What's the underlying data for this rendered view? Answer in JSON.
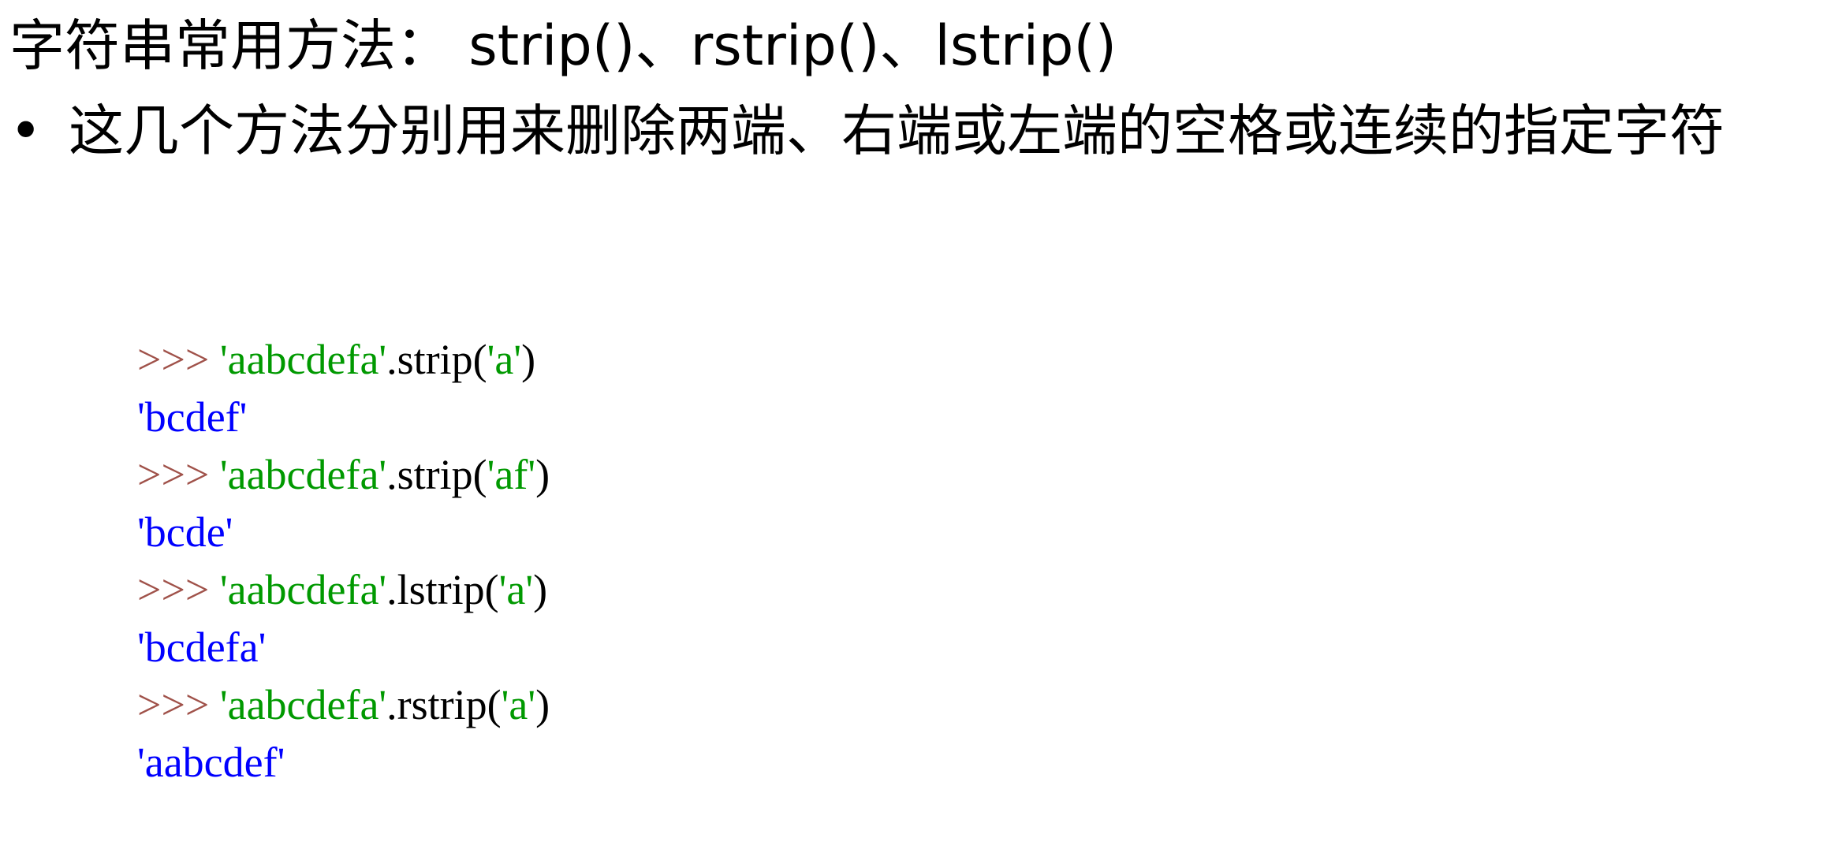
{
  "title": "字符串常用方法： strip()、rstrip()、lstrip()",
  "bullet": {
    "marker": "•",
    "text": "这几个方法分别用来删除两端、右端或左端的空格或连续的指定字符"
  },
  "colors": {
    "prompt": "#a0524a",
    "string": "#009900",
    "plain": "#000000",
    "output": "#0000ff"
  },
  "code": [
    {
      "kind": "input",
      "prompt": ">>> ",
      "str": "'aabcdefa'",
      "method": ".strip(",
      "arg": "'a'",
      "close": ")"
    },
    {
      "kind": "output",
      "text": "'bcdef'"
    },
    {
      "kind": "input",
      "prompt": ">>> ",
      "str": "'aabcdefa'",
      "method": ".strip(",
      "arg": "'af'",
      "close": ")"
    },
    {
      "kind": "output",
      "text": "'bcde'"
    },
    {
      "kind": "input",
      "prompt": ">>> ",
      "str": "'aabcdefa'",
      "method": ".lstrip(",
      "arg": "'a'",
      "close": ")"
    },
    {
      "kind": "output",
      "text": "'bcdefa'"
    },
    {
      "kind": "input",
      "prompt": ">>> ",
      "str": "'aabcdefa'",
      "method": ".rstrip(",
      "arg": "'a'",
      "close": ")"
    },
    {
      "kind": "output",
      "text": "'aabcdef'"
    }
  ]
}
